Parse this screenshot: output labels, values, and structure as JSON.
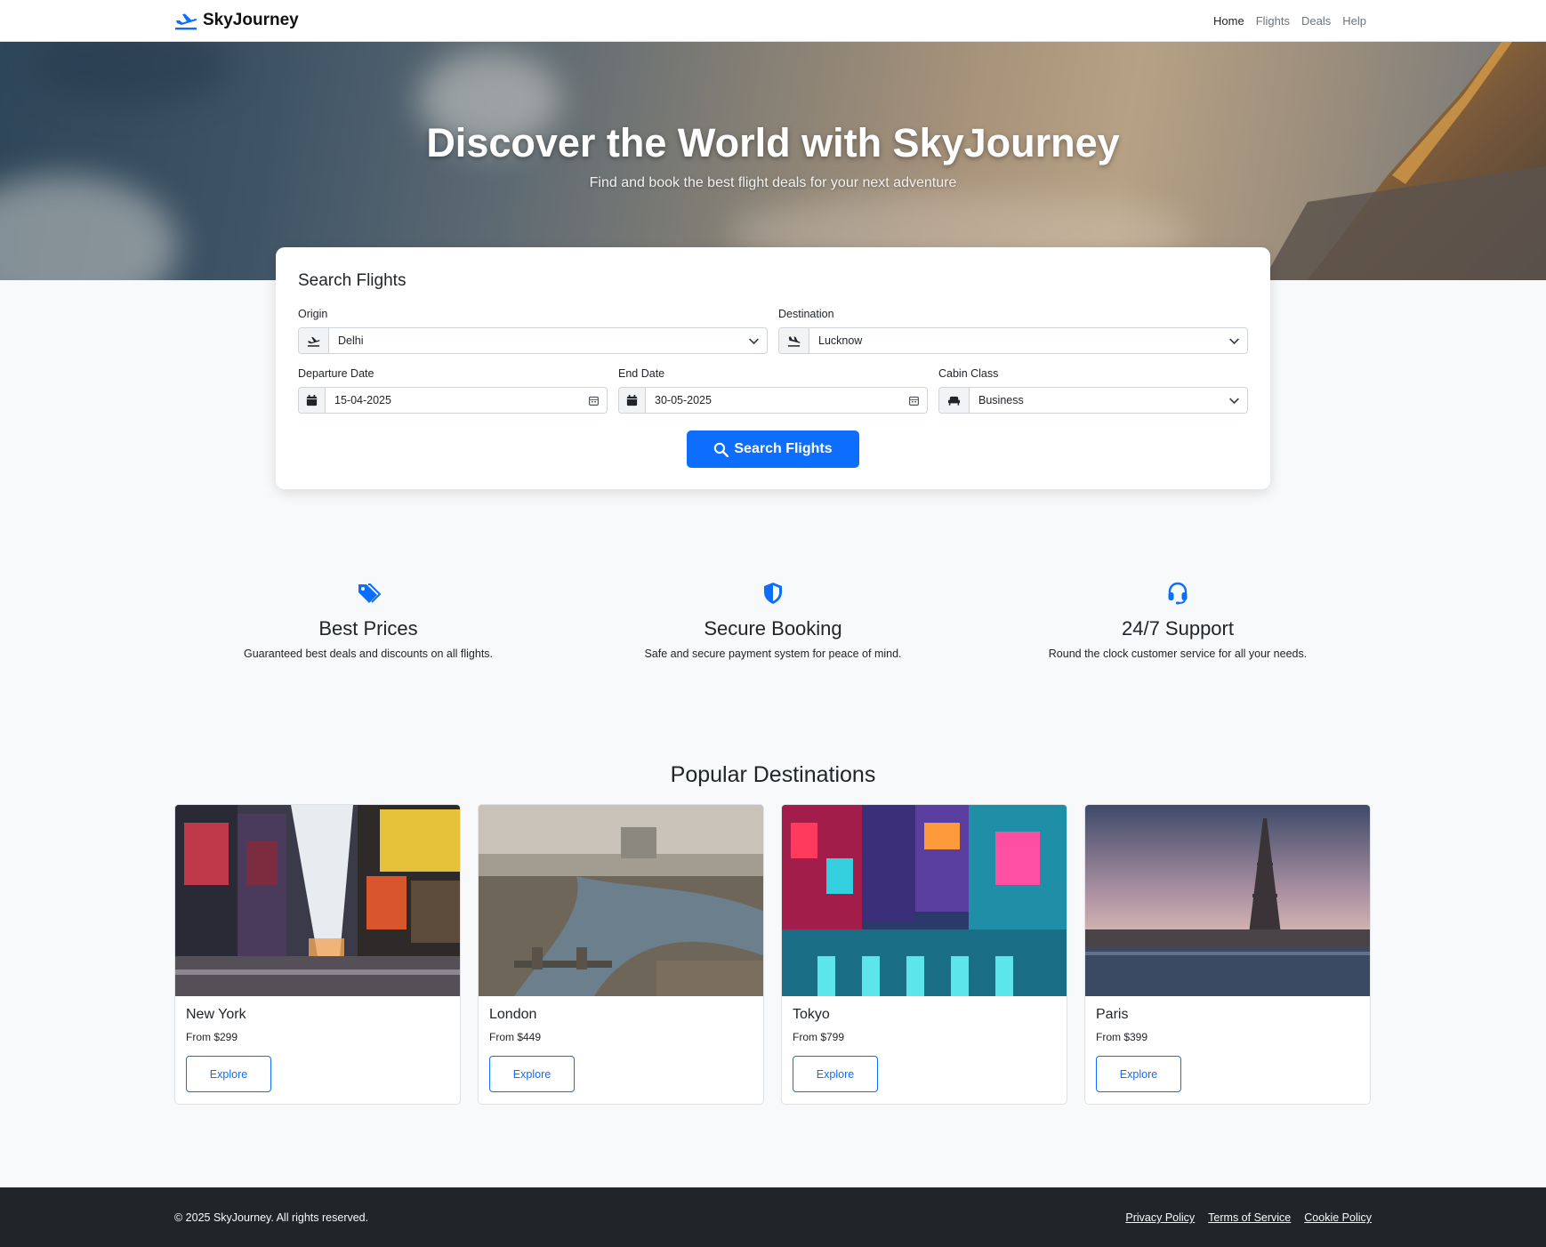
{
  "brand": {
    "name": "SkyJourney",
    "icon": "plane-departure-icon",
    "accent_color": "#0d6efd"
  },
  "nav": {
    "links": [
      "Home",
      "Flights",
      "Deals",
      "Help"
    ],
    "active": "Home"
  },
  "hero": {
    "title": "Discover the World with SkyJourney",
    "subtitle": "Find and book the best flight deals for your next adventure"
  },
  "search": {
    "title": "Search Flights",
    "origin": {
      "label": "Origin",
      "value": "Delhi",
      "icon": "plane-departure-icon"
    },
    "destination": {
      "label": "Destination",
      "value": "Lucknow",
      "icon": "plane-arrival-icon"
    },
    "departure_date": {
      "label": "Departure Date",
      "value": "15-04-2025",
      "icon": "calendar-icon"
    },
    "end_date": {
      "label": "End Date",
      "value": "30-05-2025",
      "icon": "calendar-icon"
    },
    "cabin_class": {
      "label": "Cabin Class",
      "value": "Business",
      "icon": "seat-icon"
    },
    "button_label": "Search Flights"
  },
  "features": [
    {
      "icon": "tags-icon",
      "title": "Best Prices",
      "description": "Guaranteed best deals and discounts on all flights."
    },
    {
      "icon": "shield-icon",
      "title": "Secure Booking",
      "description": "Safe and secure payment system for peace of mind."
    },
    {
      "icon": "headset-icon",
      "title": "24/7 Support",
      "description": "Round the clock customer service for all your needs."
    }
  ],
  "destinations": {
    "heading": "Popular Destinations",
    "items": [
      {
        "name": "New York",
        "price": "From $299",
        "button": "Explore"
      },
      {
        "name": "London",
        "price": "From $449",
        "button": "Explore"
      },
      {
        "name": "Tokyo",
        "price": "From $799",
        "button": "Explore"
      },
      {
        "name": "Paris",
        "price": "From $399",
        "button": "Explore"
      }
    ]
  },
  "footer": {
    "copyright": "© 2025 SkyJourney. All rights reserved.",
    "links": [
      "Privacy Policy",
      "Terms of Service",
      "Cookie Policy"
    ]
  }
}
